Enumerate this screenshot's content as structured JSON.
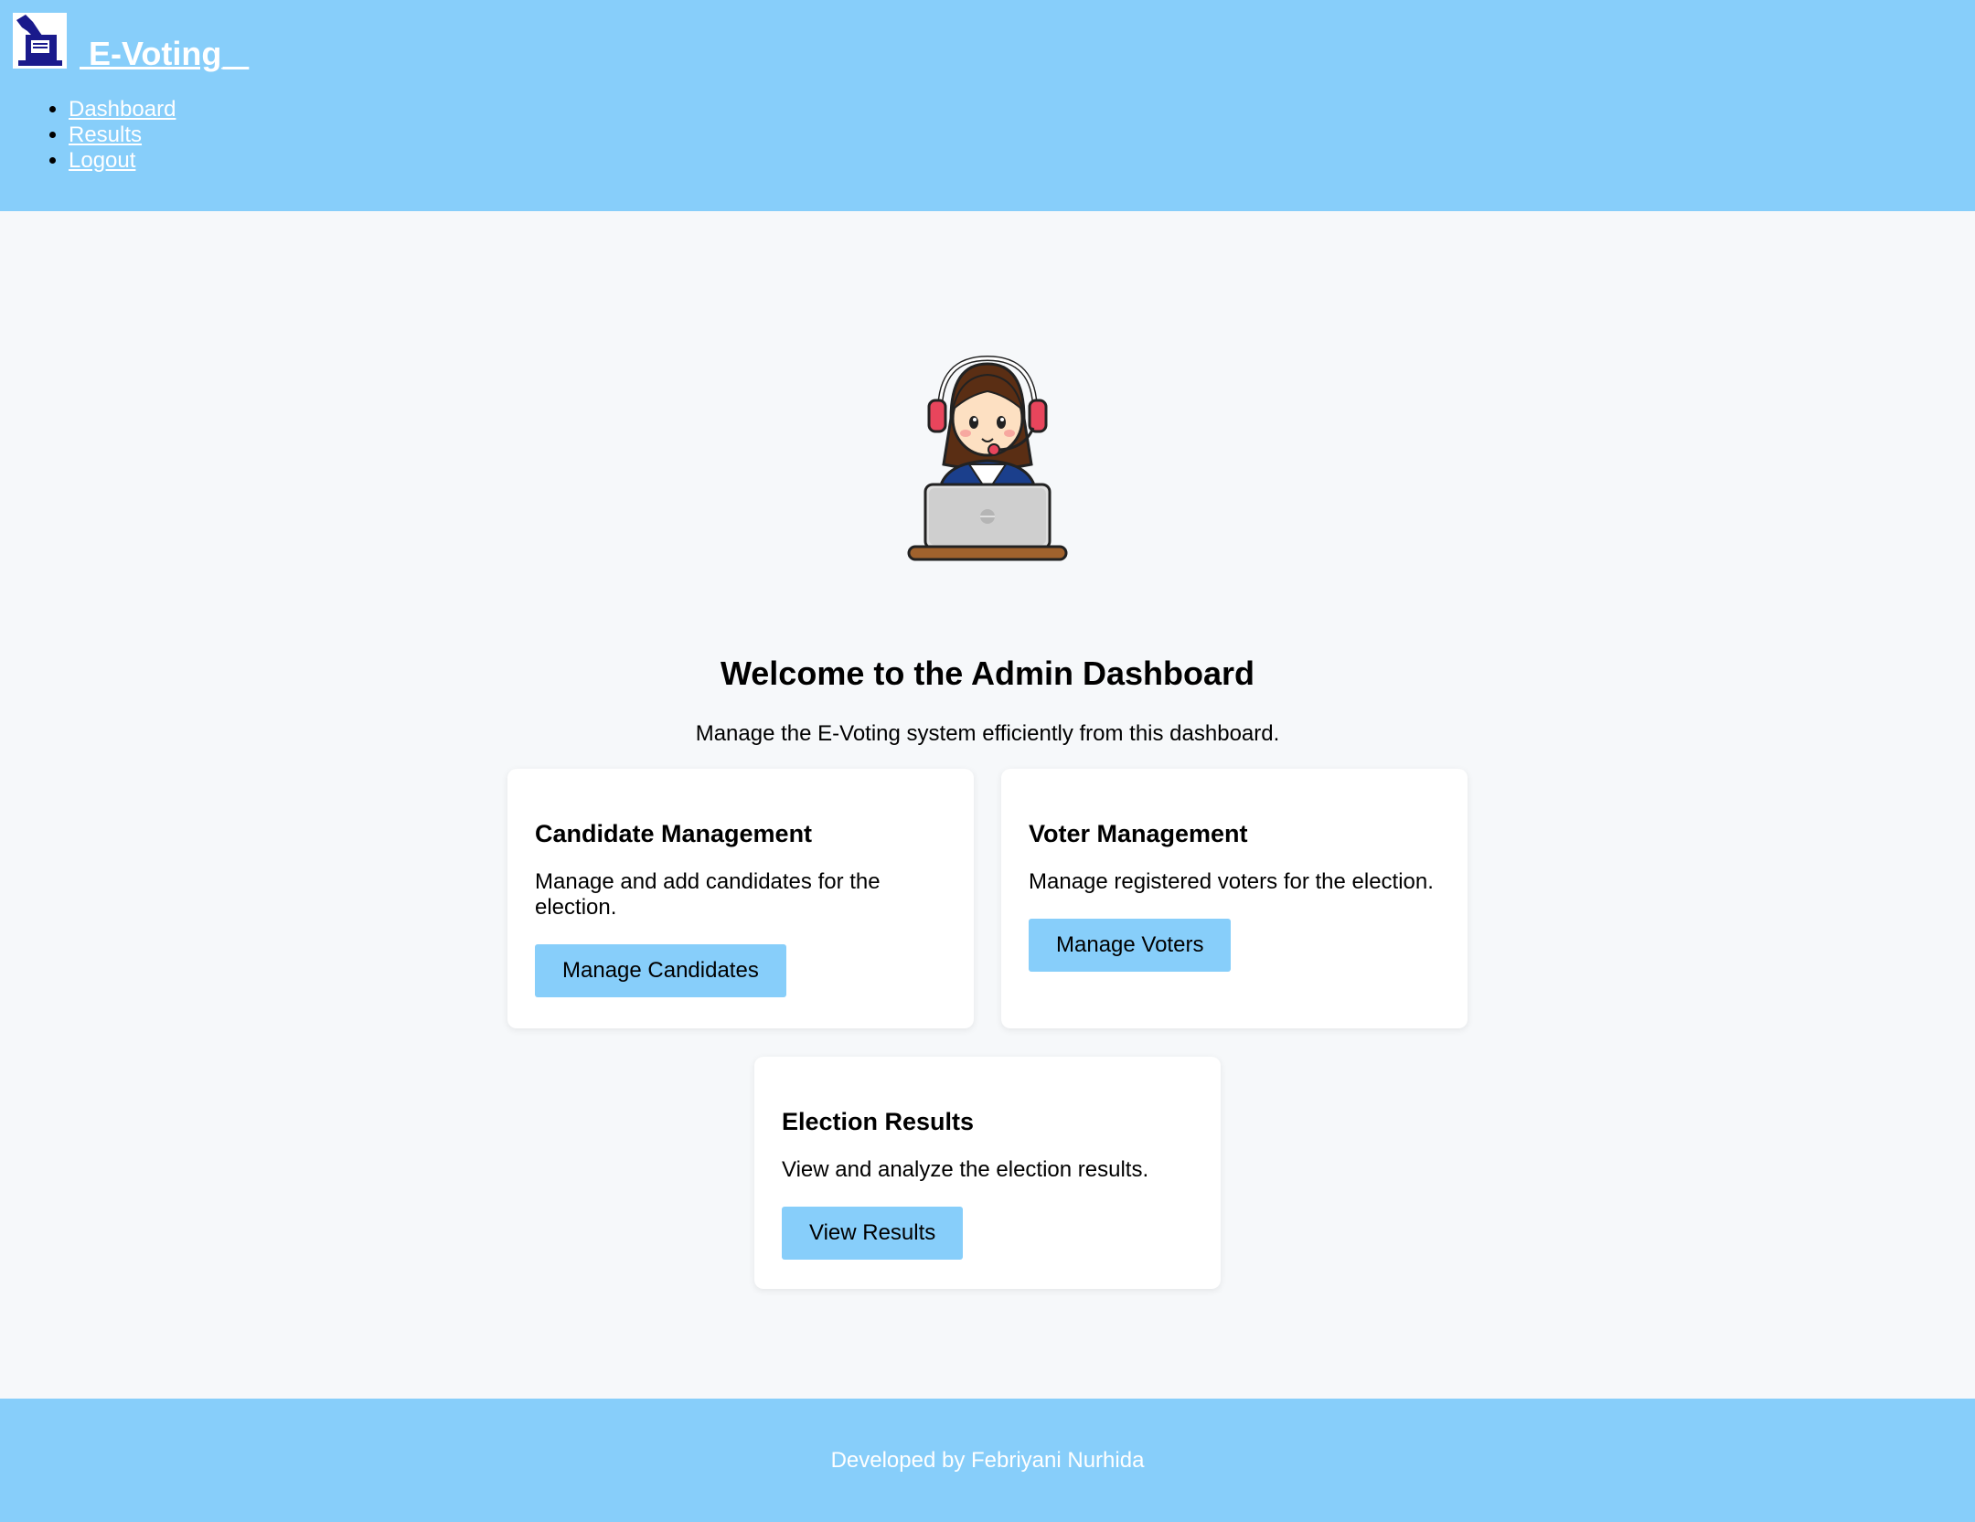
{
  "header": {
    "brand_title": " E-Voting_ ",
    "logo_icon": "ballot-box-icon",
    "nav": [
      {
        "label": "Dashboard"
      },
      {
        "label": "Results"
      },
      {
        "label": "Logout"
      }
    ],
    "background": "#87cefa"
  },
  "hero": {
    "illustration_icon": "admin-headset-laptop-illustration"
  },
  "main": {
    "title": "Welcome to the Admin Dashboard",
    "subtitle": "Manage the E-Voting system efficiently from this dashboard.",
    "cards": [
      {
        "title": "Candidate Management",
        "description": "Manage and add candidates for the election.",
        "button": "Manage Candidates"
      },
      {
        "title": "Voter Management",
        "description": "Manage registered voters for the election.",
        "button": "Manage Voters"
      },
      {
        "title": "Election Results",
        "description": "View and analyze the election results.",
        "button": "View Results"
      }
    ]
  },
  "footer": {
    "text": "Developed by Febriyani Nurhida"
  },
  "colors": {
    "accent": "#87cefa",
    "page_bg": "#f6f8fa",
    "card_bg": "#ffffff"
  }
}
